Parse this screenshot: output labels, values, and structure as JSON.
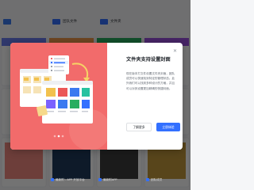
{
  "folders": [
    {
      "label": "",
      "color": "#3a7af0"
    },
    {
      "label": "团队文件",
      "color": "#3370ff"
    },
    {
      "label": "文件夹",
      "color": "#3370ff"
    }
  ],
  "modal": {
    "title": "文件夹支持设置封面",
    "description": "现在版本打文件设置文件夹封面，团队成员可以快速找到特定的管理状态。此外我们可以找到多种设计的方格，并且可以对其设置更加精确的快捷封面。",
    "close_icon": "close-icon",
    "later_label": "了解更多",
    "try_label": "立即体验",
    "accent_color": "#3370ff",
    "illustration_bg": "#f26b6b"
  },
  "bottom_labels": [
    "最新附 - APP 开放平台",
    "最新附APP",
    "团队成员"
  ]
}
